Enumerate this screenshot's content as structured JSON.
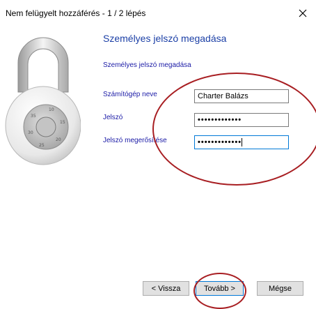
{
  "window": {
    "title": "Nem felügyelt hozzáférés - 1 / 2 lépés",
    "close_icon": "close-icon"
  },
  "content": {
    "heading": "Személyes jelszó megadása",
    "subheading": "Személyes jelszó megadása"
  },
  "form": {
    "computer_name_label": "Számítógép neve",
    "computer_name_value": "Charter Balázs",
    "password_label": "Jelszó",
    "password_value": "•••••••••••••",
    "confirm_label": "Jelszó megerősítése",
    "confirm_value": "•••••••••••••"
  },
  "buttons": {
    "back": "< Vissza",
    "next": "Tovább >",
    "cancel": "Mégse"
  },
  "colors": {
    "heading": "#1b3fa6",
    "label": "#1a1aa6",
    "annotation": "#a81e22",
    "focus": "#0078d7"
  }
}
